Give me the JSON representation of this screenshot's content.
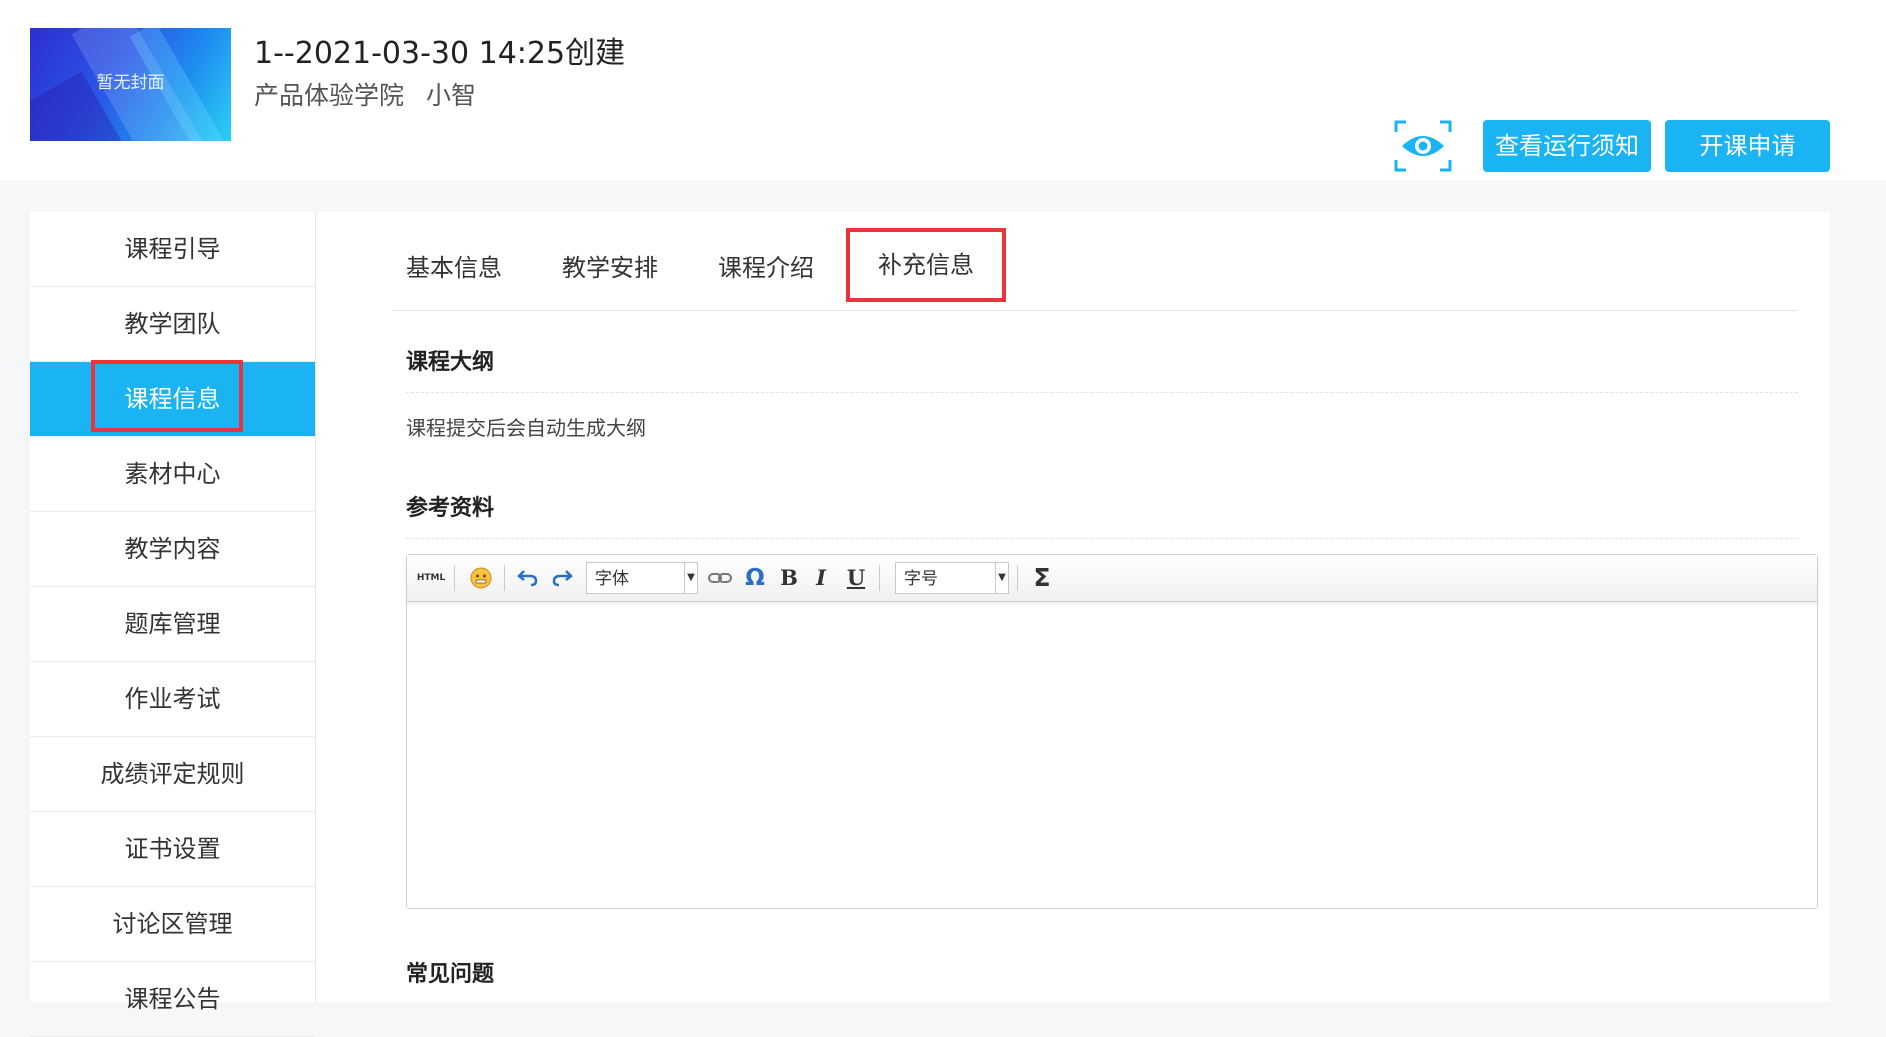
{
  "header": {
    "cover_text": "暂无封面",
    "title": "1--2021-03-30 14:25创建",
    "school": "产品体验学院",
    "teacher": "小智",
    "notice_button": "查看运行须知",
    "apply_button": "开课申请"
  },
  "sidebar": {
    "items": [
      {
        "label": "课程引导"
      },
      {
        "label": "教学团队"
      },
      {
        "label": "课程信息",
        "active": true
      },
      {
        "label": "素材中心"
      },
      {
        "label": "教学内容"
      },
      {
        "label": "题库管理"
      },
      {
        "label": "作业考试"
      },
      {
        "label": "成绩评定规则"
      },
      {
        "label": "证书设置"
      },
      {
        "label": "讨论区管理"
      },
      {
        "label": "课程公告"
      }
    ]
  },
  "tabs": [
    {
      "label": "基本信息"
    },
    {
      "label": "教学安排"
    },
    {
      "label": "课程介绍"
    },
    {
      "label": "补充信息",
      "active": true
    }
  ],
  "sections": {
    "outline_title": "课程大纲",
    "outline_text": "课程提交后会自动生成大纲",
    "reference_title": "参考资料",
    "faq_title": "常见问题"
  },
  "editor": {
    "html_label": "HTML",
    "font_label": "字体",
    "size_label": "字号",
    "bold": "B",
    "italic": "I",
    "underline": "U",
    "omega": "Ω",
    "sigma": "Σ"
  },
  "colors": {
    "accent": "#1ab4f5",
    "highlight_border": "#e8343a"
  }
}
